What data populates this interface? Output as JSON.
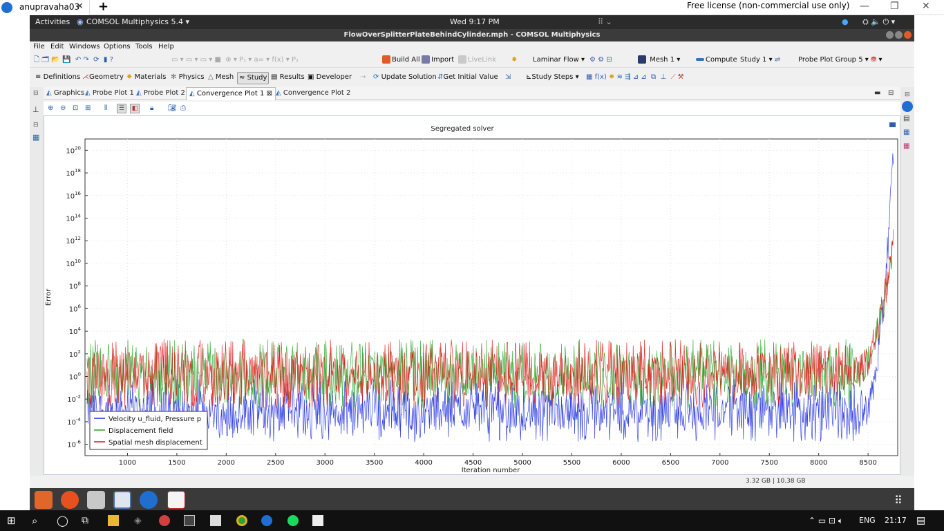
{
  "teamviewer": {
    "tab_title": "anupravaha03",
    "close_glyph": "✕",
    "new_tab_glyph": "+",
    "license": "Free license (non-commercial use only)",
    "minimize": "—",
    "restore": "❐",
    "close": "✕"
  },
  "gnome": {
    "activities": "Activities",
    "app": "COMSOL Multiphysics 5.4 ▾",
    "clock": "Wed  9:17 PM"
  },
  "window": {
    "title": "FlowOverSplitterPlateBehindCylinder.mph - COMSOL Multiphysics"
  },
  "menu": [
    "File",
    "Edit",
    "Windows",
    "Options",
    "Tools",
    "Help"
  ],
  "toolbar1": {
    "build_all": "Build All",
    "import": "Import",
    "livelink": "LiveLink",
    "laminar_flow": "Laminar Flow",
    "mesh": "Mesh 1",
    "compute": "Compute",
    "study": "Study 1",
    "probe_group": "Probe Plot Group 5"
  },
  "ribbon": {
    "definitions": "Definitions",
    "geometry": "Geometry",
    "materials": "Materials",
    "physics": "Physics",
    "mesh": "Mesh",
    "study": "Study",
    "results": "Results",
    "developer": "Developer",
    "update_solution": "Update Solution",
    "get_initial_value": "Get Initial Value",
    "study_steps": "Study Steps"
  },
  "tabs": [
    "Graphics",
    "Probe Plot 1",
    "Probe Plot 2",
    "Convergence Plot 1",
    "Convergence Plot 2"
  ],
  "active_tab_close": "⊠",
  "status": {
    "memory": "3.32 GB | 10.38 GB"
  },
  "taskbar": {
    "language": "ENG",
    "time": "21:17"
  },
  "colors": {
    "velocity": "#1f2fe0",
    "displacement": "#1fa21f",
    "spatial": "#e01010"
  },
  "chart_data": {
    "type": "line",
    "title": "Segregated solver",
    "xlabel": "Iteration number",
    "ylabel": "Error",
    "yscale": "log",
    "xlim": [
      570,
      8800
    ],
    "ylim": [
      1e-07,
      1e+21
    ],
    "x_ticks": [
      1000,
      1500,
      2000,
      2500,
      3000,
      3500,
      4000,
      4500,
      5000,
      5500,
      6000,
      6500,
      7000,
      7500,
      8000,
      8500
    ],
    "y_tick_exponents": [
      -6,
      -4,
      -2,
      0,
      2,
      4,
      6,
      8,
      10,
      12,
      14,
      16,
      18,
      20
    ],
    "legend_position": "bottom-left",
    "series": [
      {
        "name": "Velocity u_fluid, Pressure p",
        "color": "#1f2fe0",
        "typical_range_log10": [
          -5,
          -1
        ],
        "final_peak_log10": 20.5,
        "divergence_start": 8450
      },
      {
        "name": "Displacement field",
        "color": "#1fa21f",
        "typical_range_log10": [
          -2,
          2.5
        ],
        "final_peak_log10": 12,
        "divergence_start": 8350
      },
      {
        "name": "Spatial mesh displacement",
        "color": "#e01010",
        "typical_range_log10": [
          -2,
          2.5
        ],
        "final_peak_log10": 12,
        "divergence_start": 8350
      }
    ]
  }
}
